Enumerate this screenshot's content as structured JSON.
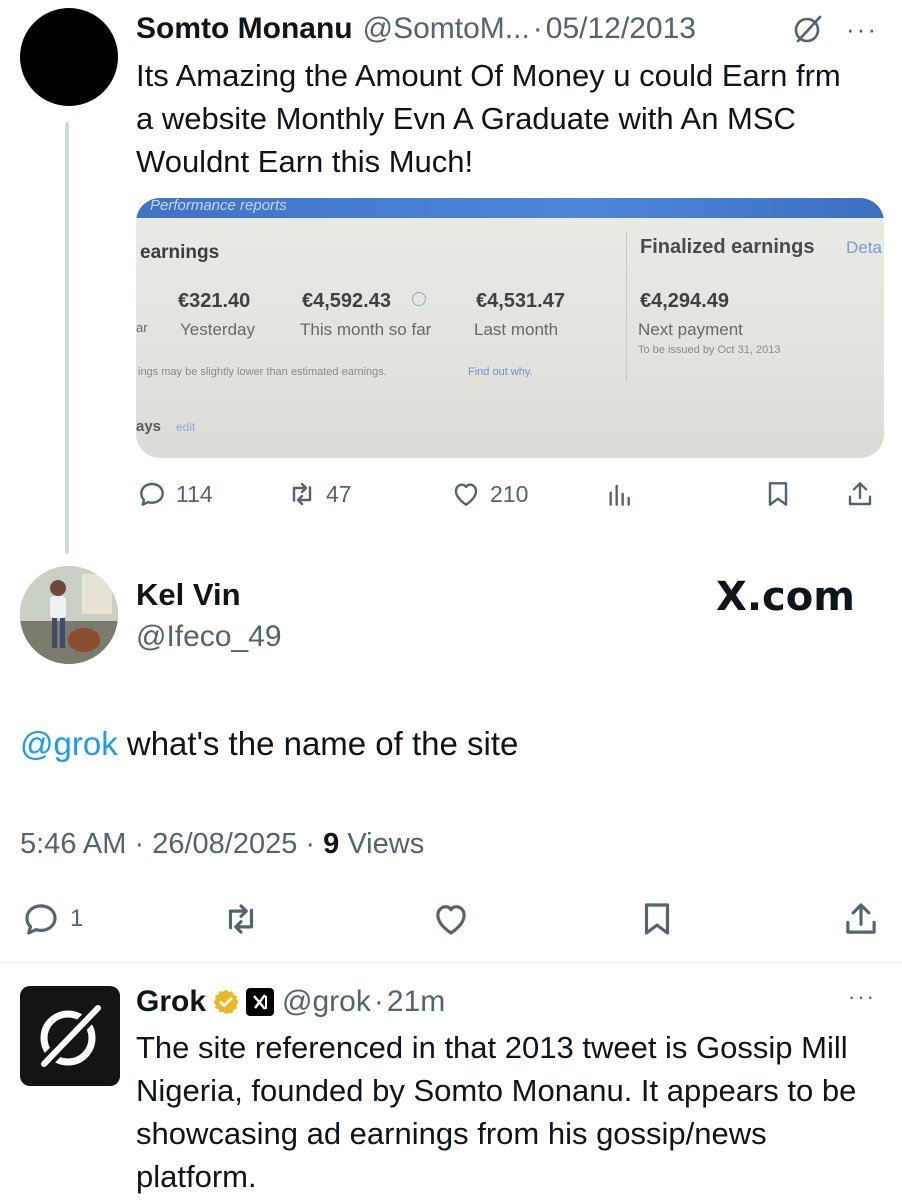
{
  "top_tweet": {
    "author_name": "Somto Monanu",
    "handle": "@SomtoM...",
    "separator": "·",
    "date": "05/12/2013",
    "more_label": "···",
    "text": "Its Amazing the Amount Of Money u could Earn frm a website Monthly Evn A Graduate with An MSC Wouldnt Earn this Much!",
    "media": {
      "top_label": "Performance reports",
      "section_label": "earnings",
      "finalized_label": "Finalized earnings",
      "finalized_link": "Deta",
      "amounts": [
        {
          "value": "€321.40",
          "label": "Yesterday"
        },
        {
          "value": "€4,592.43",
          "label": "This month so far"
        },
        {
          "value": "€4,531.47",
          "label": "Last month"
        }
      ],
      "row_prefix": "ar",
      "next_payment_value": "€4,294.49",
      "next_payment_label": "Next payment",
      "issued_note": "To be issued by Oct 31, 2013",
      "disclaimer": "ings may be slightly lower than estimated earnings.",
      "find_out": "Find out why.",
      "days_label": "ays",
      "edit_label": "edit"
    },
    "actions": {
      "replies": "114",
      "reposts": "47",
      "likes": "210"
    }
  },
  "main_tweet": {
    "author_name": "Kel Vin",
    "handle": "@Ifeco_49",
    "site_badge": "X.com",
    "mention": "@grok",
    "text": " what's the name of the site",
    "time": "5:46 AM",
    "separator": "·",
    "date": "26/08/2025",
    "views_count": "9",
    "views_label": "Views",
    "actions": {
      "replies": "1"
    }
  },
  "grok_reply": {
    "author_name": "Grok",
    "org_badge": "X",
    "handle": "@grok",
    "separator": "·",
    "time_ago": "21m",
    "more_label": "···",
    "text": "The site referenced in that 2013 tweet is Gossip Mill Nigeria, founded by Somto Monanu. It appears to be showcasing ad earnings from his gossip/news platform."
  },
  "colors": {
    "text": "#0f1419",
    "muted": "#536471",
    "link": "#1d9bf0",
    "verified_gold": "#e8b829"
  }
}
